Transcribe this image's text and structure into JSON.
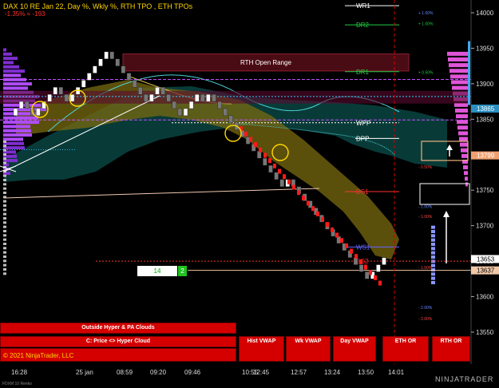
{
  "header": {
    "title": "DAX 10 RE Jan 22, Day %, Wkly %, RTH TPO , ETH TPOs",
    "change": "-1.35% = -193"
  },
  "chart_data": {
    "type": "candlestick",
    "instrument": "DAX 10 RE Jan 22",
    "ylim": [
      13515,
      14020
    ],
    "y_ticks": [
      13550,
      13600,
      13650,
      13700,
      13750,
      13800,
      13850,
      13900,
      13950,
      14000
    ],
    "x_ticks": [
      "16:28",
      "25 jan",
      "08:59",
      "09:20",
      "09:46",
      "10:55",
      "12:45",
      "12:57",
      "13:24",
      "13:50",
      "14:01"
    ],
    "price_markers": [
      {
        "label": "13865",
        "value": 13865,
        "color": "#2a8fbf"
      },
      {
        "label": "13799",
        "value": 13799,
        "color": "#f0a070"
      },
      {
        "label": "13653",
        "value": 13653,
        "color": "#ffffff"
      },
      {
        "label": "13637",
        "value": 13637,
        "color": "#f0c8a8"
      }
    ],
    "levels": [
      {
        "name": "WR1",
        "value": 14010,
        "color": "#ffffff"
      },
      {
        "name": "DR2",
        "value": 13983,
        "color": "#22cc44"
      },
      {
        "name": "DR1",
        "value": 13917,
        "color": "#22cc44"
      },
      {
        "name": "WPP",
        "value": 13845,
        "color": "#ffffff"
      },
      {
        "name": "DPP",
        "value": 13823,
        "color": "#ffffff"
      },
      {
        "name": "DS1",
        "value": 13748,
        "color": "#ff3030"
      },
      {
        "name": "WS1",
        "value": 13670,
        "color": "#6666ff"
      },
      {
        "name": "DS2",
        "value": 13650,
        "color": "#ff3030"
      }
    ],
    "pct_labels": [
      {
        "text": "+ 1.00%",
        "value": 14000,
        "color": "#6688ff"
      },
      {
        "text": "+ 1.00%",
        "value": 13985,
        "color": "#22cc44"
      },
      {
        "text": "+ 0.50%",
        "value": 13916,
        "color": "#22cc44"
      },
      {
        "text": "- 0.50%",
        "value": 13783,
        "color": "#ff4040"
      },
      {
        "text": "- 1.00%",
        "value": 13727,
        "color": "#6688ff"
      },
      {
        "text": "- 1.00%",
        "value": 13713,
        "color": "#ff4040"
      },
      {
        "text": "- 1.50%",
        "value": 13641,
        "color": "#ff4040"
      },
      {
        "text": "- 2.00%",
        "value": 13585,
        "color": "#6688ff"
      },
      {
        "text": "- 2.00%",
        "value": 13569,
        "color": "#ff4040"
      }
    ],
    "rth_open_range": {
      "label": "RTH Open Range",
      "high": 13942,
      "low": 13918
    },
    "bricks": [
      {
        "o": 13855,
        "c": 13865
      },
      {
        "o": 13865,
        "c": 13875
      },
      {
        "o": 13875,
        "c": 13865
      },
      {
        "o": 13865,
        "c": 13855
      },
      {
        "o": 13855,
        "c": 13865
      },
      {
        "o": 13865,
        "c": 13875
      },
      {
        "o": 13875,
        "c": 13885
      },
      {
        "o": 13885,
        "c": 13895
      },
      {
        "o": 13895,
        "c": 13885
      },
      {
        "o": 13885,
        "c": 13875
      },
      {
        "o": 13875,
        "c": 13885
      },
      {
        "o": 13885,
        "c": 13895
      },
      {
        "o": 13895,
        "c": 13905
      },
      {
        "o": 13905,
        "c": 13915
      },
      {
        "o": 13915,
        "c": 13925
      },
      {
        "o": 13925,
        "c": 13935
      },
      {
        "o": 13935,
        "c": 13945
      },
      {
        "o": 13945,
        "c": 13935
      },
      {
        "o": 13935,
        "c": 13925
      },
      {
        "o": 13925,
        "c": 13915
      },
      {
        "o": 13915,
        "c": 13905
      },
      {
        "o": 13905,
        "c": 13895
      },
      {
        "o": 13895,
        "c": 13885
      },
      {
        "o": 13885,
        "c": 13875
      },
      {
        "o": 13875,
        "c": 13885
      },
      {
        "o": 13885,
        "c": 13895
      },
      {
        "o": 13895,
        "c": 13885
      },
      {
        "o": 13885,
        "c": 13875
      },
      {
        "o": 13875,
        "c": 13865
      },
      {
        "o": 13865,
        "c": 13855
      },
      {
        "o": 13855,
        "c": 13865
      },
      {
        "o": 13865,
        "c": 13875
      },
      {
        "o": 13875,
        "c": 13885
      },
      {
        "o": 13885,
        "c": 13875
      },
      {
        "o": 13875,
        "c": 13885
      },
      {
        "o": 13885,
        "c": 13875
      },
      {
        "o": 13875,
        "c": 13865
      },
      {
        "o": 13865,
        "c": 13855
      },
      {
        "o": 13855,
        "c": 13845
      },
      {
        "o": 13845,
        "c": 13835
      },
      {
        "o": 13835,
        "c": 13825
      },
      {
        "o": 13825,
        "c": 13815
      },
      {
        "o": 13815,
        "c": 13805
      },
      {
        "o": 13805,
        "c": 13795
      },
      {
        "o": 13795,
        "c": 13785
      },
      {
        "o": 13785,
        "c": 13775
      },
      {
        "o": 13775,
        "c": 13765
      },
      {
        "o": 13765,
        "c": 13755
      },
      {
        "o": 13755,
        "c": 13765
      },
      {
        "o": 13765,
        "c": 13755
      },
      {
        "o": 13755,
        "c": 13745
      },
      {
        "o": 13745,
        "c": 13735
      },
      {
        "o": 13735,
        "c": 13725
      },
      {
        "o": 13725,
        "c": 13715
      },
      {
        "o": 13715,
        "c": 13705
      },
      {
        "o": 13705,
        "c": 13695
      },
      {
        "o": 13695,
        "c": 13685
      },
      {
        "o": 13685,
        "c": 13675
      },
      {
        "o": 13675,
        "c": 13665
      },
      {
        "o": 13665,
        "c": 13655
      },
      {
        "o": 13655,
        "c": 13645
      },
      {
        "o": 13645,
        "c": 13635
      },
      {
        "o": 13635,
        "c": 13625
      },
      {
        "o": 13625,
        "c": 13635
      },
      {
        "o": 13635,
        "c": 13645
      },
      {
        "o": 13645,
        "c": 13655
      }
    ]
  },
  "counter": {
    "value": "14",
    "level": "2"
  },
  "buttons": {
    "outside_hyper": "Outside Hyper & PA Clouds",
    "price_hyper": "C: Price <> Hyper Cloud",
    "hist_vwap": "Hist VWAP",
    "wk_vwap": "Wk VWAP",
    "day_vwap": "Day VWAP",
    "eth_or": "ETH OR",
    "rth_or": "RTH OR"
  },
  "footer": {
    "copyright": "© 2021 NinjaTrader, LLC",
    "brand": "NINJATRADER",
    "series": "FDXM 10 Renko"
  }
}
